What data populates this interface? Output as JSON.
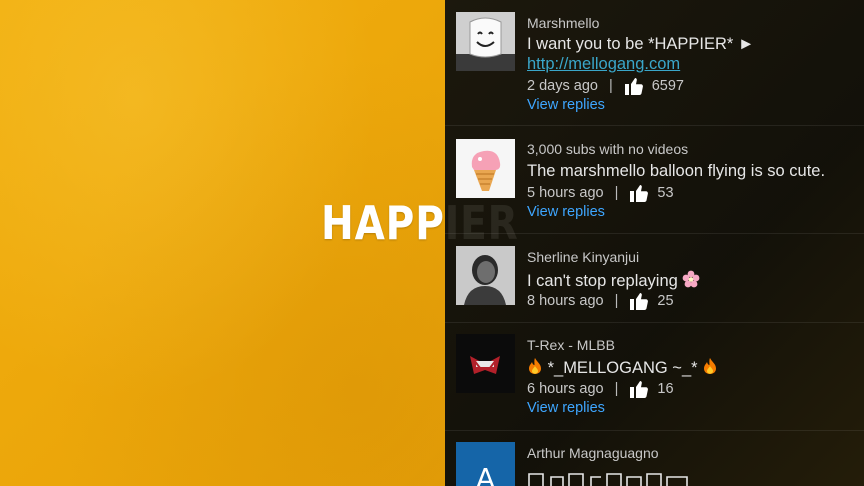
{
  "video": {
    "title": "HAPPIER"
  },
  "comments": [
    {
      "author": "Marshmello",
      "text": "I want you to be *HAPPIER* ►",
      "link": "http://mellogang.com",
      "time": "2 days ago",
      "likes": "6597",
      "replies_label": "View replies",
      "avatar_icon": "marshmello-avatar"
    },
    {
      "author": "3,000 subs with no videos",
      "text": "The marshmello balloon flying is so cute.",
      "time": "5 hours ago",
      "likes": "53",
      "replies_label": "View replies",
      "avatar_icon": "ice-cream-avatar"
    },
    {
      "author": "Sherline Kinyanjui",
      "text": "I can't stop replaying",
      "text_emoji": "flower-emoji",
      "time": "8 hours ago",
      "likes": "25",
      "avatar_icon": "person-photo-avatar"
    },
    {
      "author": "T-Rex - MLBB",
      "text": "*_MELLOGANG ~_*",
      "text_emoji": "fire-emoji",
      "time": "6 hours ago",
      "likes": "16",
      "replies_label": "View replies",
      "avatar_icon": "mlbb-logo-avatar"
    },
    {
      "author": "Arthur Magnaguagno",
      "avatar_letter": "A",
      "avatar_color": "#1565a8"
    }
  ],
  "separator": "|",
  "colors": {
    "video_bg": "#f0ab0d",
    "link": "#3aa6c9",
    "replies": "#3ea6ff"
  }
}
